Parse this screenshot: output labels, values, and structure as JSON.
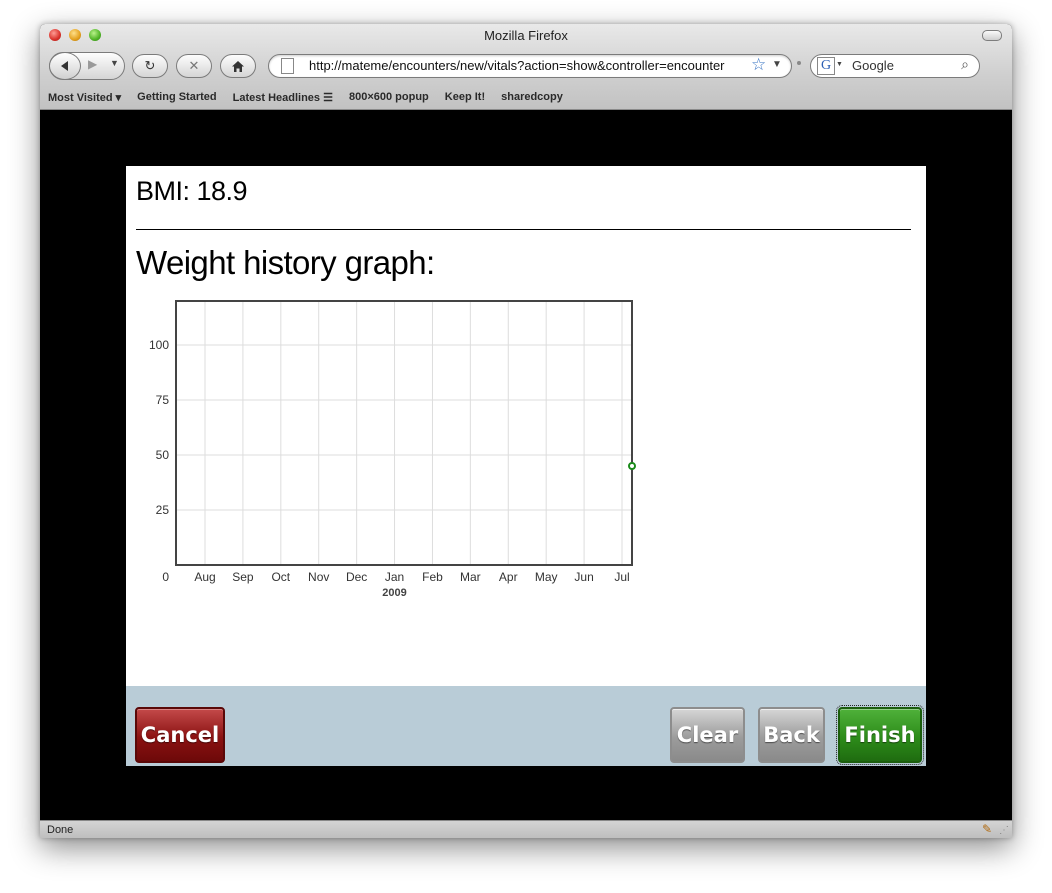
{
  "window": {
    "title": "Mozilla Firefox"
  },
  "toolbar": {
    "url": "http://mateme/encounters/new/vitals?action=show&controller=encounter",
    "search_placeholder": "Google"
  },
  "bookmarks": [
    "Most Visited ▾",
    "Getting Started",
    "Latest Headlines ☰",
    "800×600 popup",
    "Keep It!",
    "sharedcopy"
  ],
  "main": {
    "bmi": "BMI: 18.9",
    "graph_title": "Weight history graph:"
  },
  "chart_data": {
    "type": "scatter",
    "title": "",
    "xlabel": "",
    "ylabel": "",
    "categories": [
      "Aug",
      "Sep",
      "Oct",
      "Nov",
      "Dec",
      "Jan",
      "Feb",
      "Mar",
      "Apr",
      "May",
      "Jun",
      "Jul"
    ],
    "year_label": "2009",
    "year_under": "Jan",
    "y_ticks": [
      0,
      25,
      50,
      75,
      100
    ],
    "ylim": [
      0,
      120
    ],
    "grid": true,
    "series": [
      {
        "points": [
          {
            "x": "Jul",
            "y": 45
          }
        ]
      }
    ],
    "colors": {
      "point": "#1a8a1a",
      "frame": "#444444",
      "grid": "#dddddd"
    }
  },
  "footer": {
    "cancel": "Cancel",
    "clear": "Clear",
    "back": "Back",
    "finish": "Finish"
  },
  "status": {
    "text": "Done"
  }
}
